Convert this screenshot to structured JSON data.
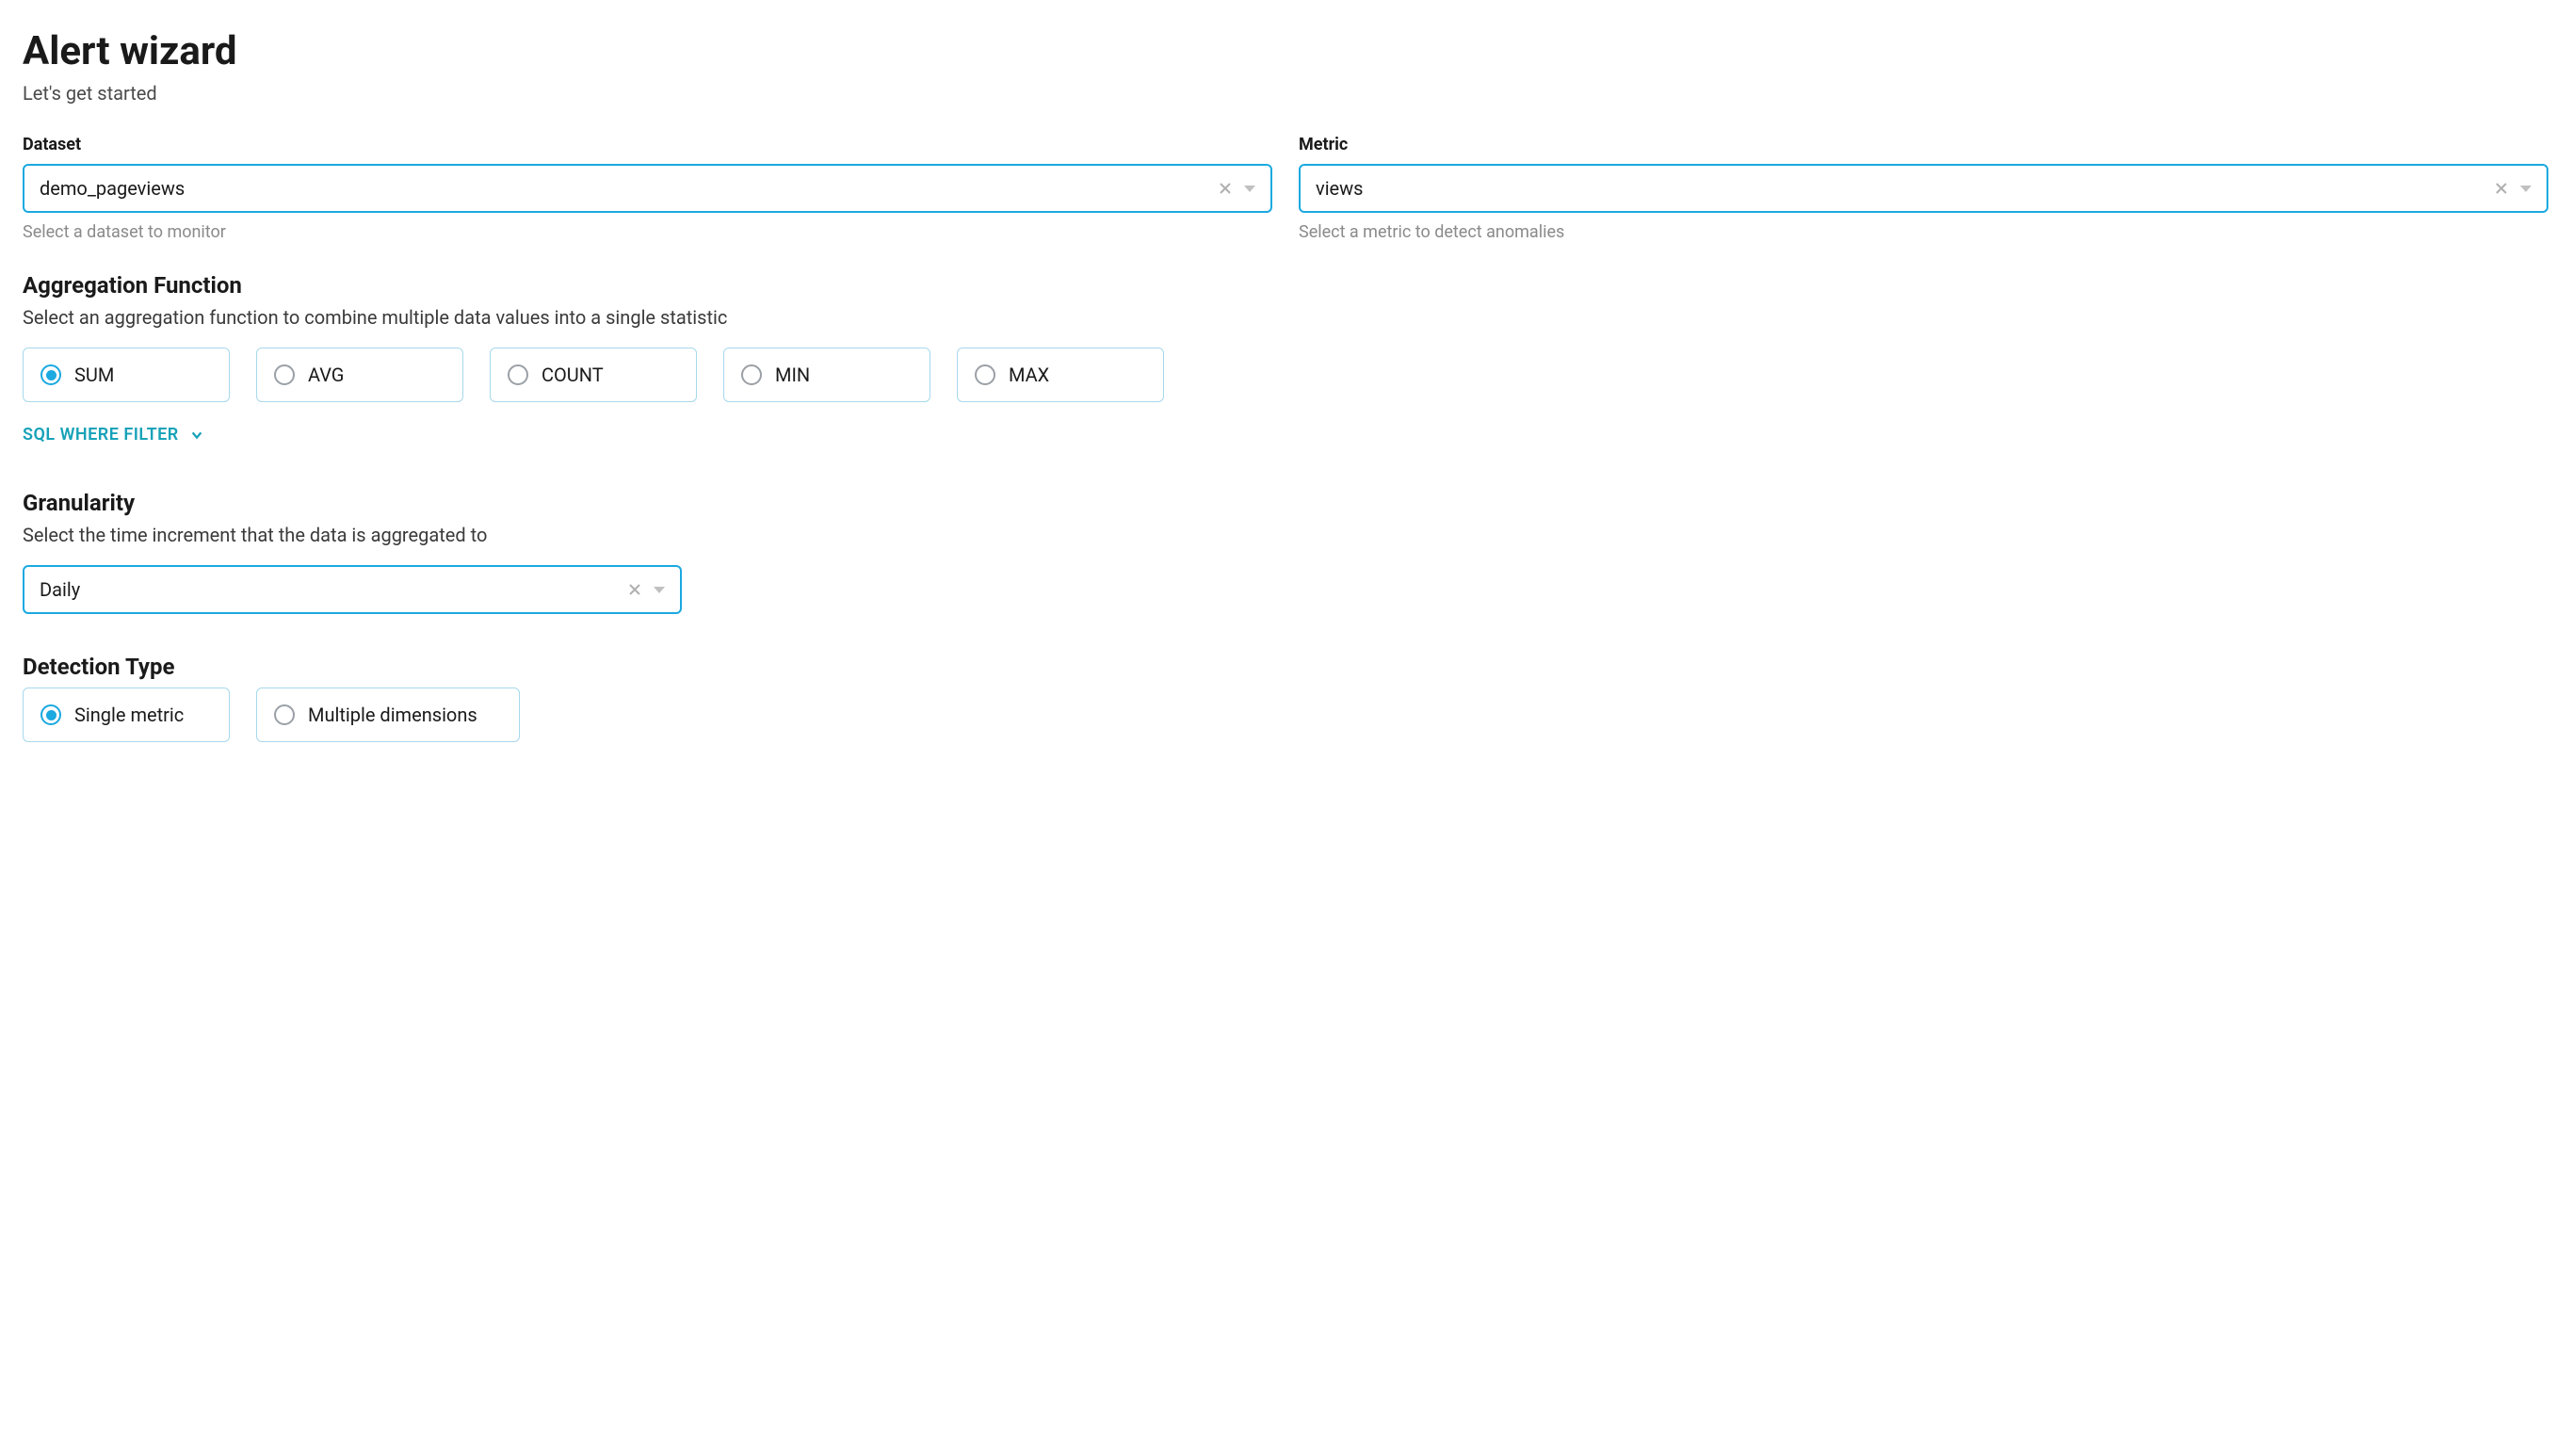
{
  "header": {
    "title": "Alert wizard",
    "subtitle": "Let's get started"
  },
  "dataset": {
    "label": "Dataset",
    "value": "demo_pageviews",
    "helper": "Select a dataset to monitor"
  },
  "metric": {
    "label": "Metric",
    "value": "views",
    "helper": "Select a metric to detect anomalies"
  },
  "aggregation": {
    "title": "Aggregation Function",
    "desc": "Select an aggregation function to combine multiple data values into a single statistic",
    "options": [
      {
        "label": "SUM",
        "selected": true
      },
      {
        "label": "AVG",
        "selected": false
      },
      {
        "label": "COUNT",
        "selected": false
      },
      {
        "label": "MIN",
        "selected": false
      },
      {
        "label": "MAX",
        "selected": false
      }
    ],
    "sql_filter_label": "SQL WHERE FILTER"
  },
  "granularity": {
    "title": "Granularity",
    "desc": "Select the time increment that the data is aggregated to",
    "value": "Daily"
  },
  "detection": {
    "title": "Detection Type",
    "options": [
      {
        "label": "Single metric",
        "selected": true
      },
      {
        "label": "Multiple dimensions",
        "selected": false
      }
    ]
  }
}
